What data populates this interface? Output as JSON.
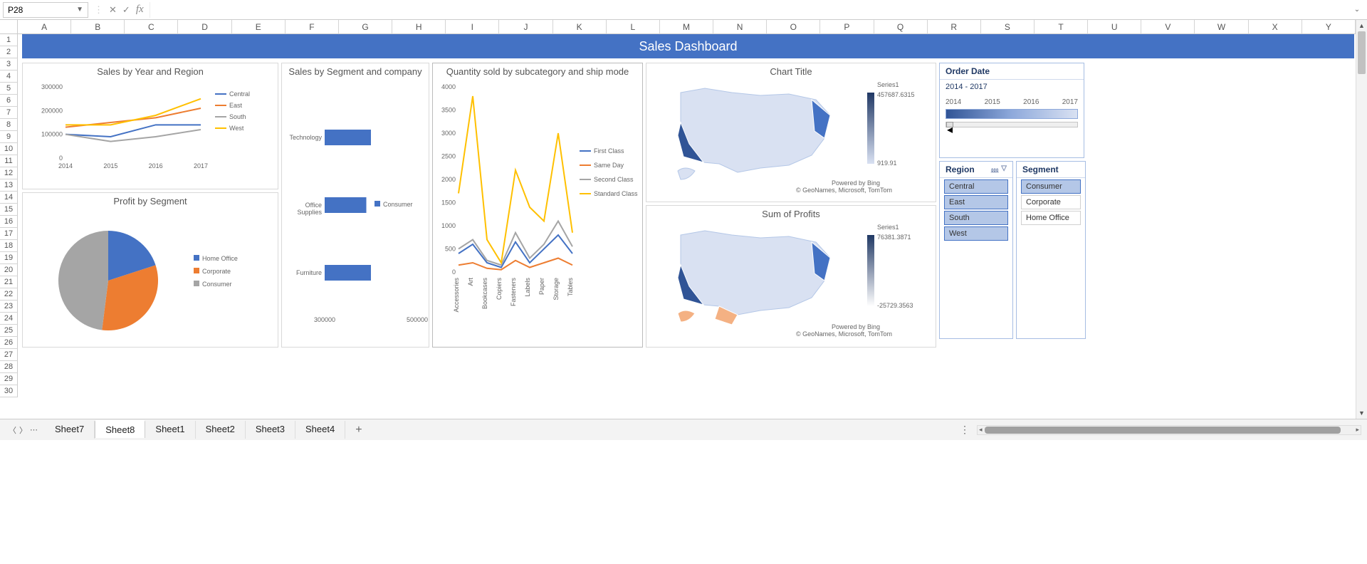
{
  "name_box": "P28",
  "formula": "",
  "col_headers": [
    "A",
    "B",
    "C",
    "D",
    "E",
    "F",
    "G",
    "H",
    "I",
    "J",
    "K",
    "L",
    "M",
    "N",
    "O",
    "P",
    "Q",
    "R",
    "S",
    "T",
    "U",
    "V",
    "W",
    "X",
    "Y"
  ],
  "row_headers": [
    "1",
    "2",
    "3",
    "4",
    "5",
    "6",
    "7",
    "8",
    "9",
    "10",
    "11",
    "12",
    "13",
    "14",
    "15",
    "16",
    "17",
    "18",
    "19",
    "20",
    "21",
    "22",
    "23",
    "24",
    "25",
    "26",
    "27",
    "28",
    "29",
    "30"
  ],
  "dashboard_title": "Sales Dashboard",
  "chart1_title": "Sales by Year and Region",
  "chart2_title": "Profit by Segment",
  "chart3_title": "Sales by Segment and company",
  "chart4_title": "Quantity sold by subcategory and ship mode",
  "chart5_title": "Chart Title",
  "chart6_title": "Sum of Profits",
  "map_attrib1": "Powered by Bing",
  "map_attrib2": "© GeoNames, Microsoft, TomTom",
  "map1_series": "Series1",
  "map1_max": "457687.6315",
  "map1_min": "919.91",
  "map2_series": "Series1",
  "map2_max": "76381.3871",
  "map2_min": "-25729.3563",
  "timeline_title": "Order Date",
  "timeline_range": "2014  - 2017",
  "timeline_years": [
    "2014",
    "2015",
    "2016",
    "2017"
  ],
  "region_title": "Region",
  "region_items": [
    "Central",
    "East",
    "South",
    "West"
  ],
  "segment_title": "Segment",
  "segment_items": [
    "Consumer",
    "Corporate",
    "Home Office"
  ],
  "sheet_tabs": [
    "Sheet7",
    "Sheet8",
    "Sheet1",
    "Sheet2",
    "Sheet3",
    "Sheet4"
  ],
  "active_tab": "Sheet8",
  "chart_data": [
    {
      "type": "line",
      "title": "Sales by Year and Region",
      "categories": [
        "2014",
        "2015",
        "2016",
        "2017"
      ],
      "ylim": [
        0,
        300000
      ],
      "series": [
        {
          "name": "Central",
          "color": "#4472C4",
          "values": [
            100000,
            90000,
            140000,
            140000
          ]
        },
        {
          "name": "East",
          "color": "#ED7D31",
          "values": [
            130000,
            150000,
            170000,
            210000
          ]
        },
        {
          "name": "South",
          "color": "#A5A5A5",
          "values": [
            100000,
            70000,
            90000,
            120000
          ]
        },
        {
          "name": "West",
          "color": "#FFC000",
          "values": [
            140000,
            140000,
            180000,
            250000
          ]
        }
      ]
    },
    {
      "type": "pie",
      "title": "Profit by Segment",
      "series": [
        {
          "name": "Home Office",
          "color": "#4472C4",
          "value": 20
        },
        {
          "name": "Corporate",
          "color": "#ED7D31",
          "value": 32
        },
        {
          "name": "Consumer",
          "color": "#A5A5A5",
          "value": 48
        }
      ]
    },
    {
      "type": "bar",
      "title": "Sales by Segment and company",
      "categories": [
        "Technology",
        "Office Supplies",
        "Furniture"
      ],
      "xlim": [
        300000,
        500000
      ],
      "series": [
        {
          "name": "Consumer",
          "color": "#4472C4",
          "values": [
            400000,
            390000,
            400000
          ]
        }
      ]
    },
    {
      "type": "line",
      "title": "Quantity sold by subcategory and ship mode",
      "categories": [
        "Accessories",
        "Art",
        "Bookcases",
        "Copiers",
        "Fasteners",
        "Labels",
        "Paper",
        "Storage",
        "Tables"
      ],
      "ylim": [
        0,
        4000
      ],
      "series": [
        {
          "name": "First Class",
          "color": "#4472C4",
          "values": [
            400,
            600,
            200,
            100,
            650,
            200,
            500,
            800,
            400
          ]
        },
        {
          "name": "Same Day",
          "color": "#ED7D31",
          "values": [
            150,
            200,
            80,
            50,
            250,
            100,
            200,
            300,
            150
          ]
        },
        {
          "name": "Second Class",
          "color": "#A5A5A5",
          "values": [
            500,
            700,
            250,
            150,
            850,
            300,
            600,
            1100,
            550
          ]
        },
        {
          "name": "Standard Class",
          "color": "#FFC000",
          "values": [
            1700,
            3800,
            700,
            200,
            2200,
            1400,
            1100,
            3000,
            850
          ]
        }
      ]
    }
  ]
}
